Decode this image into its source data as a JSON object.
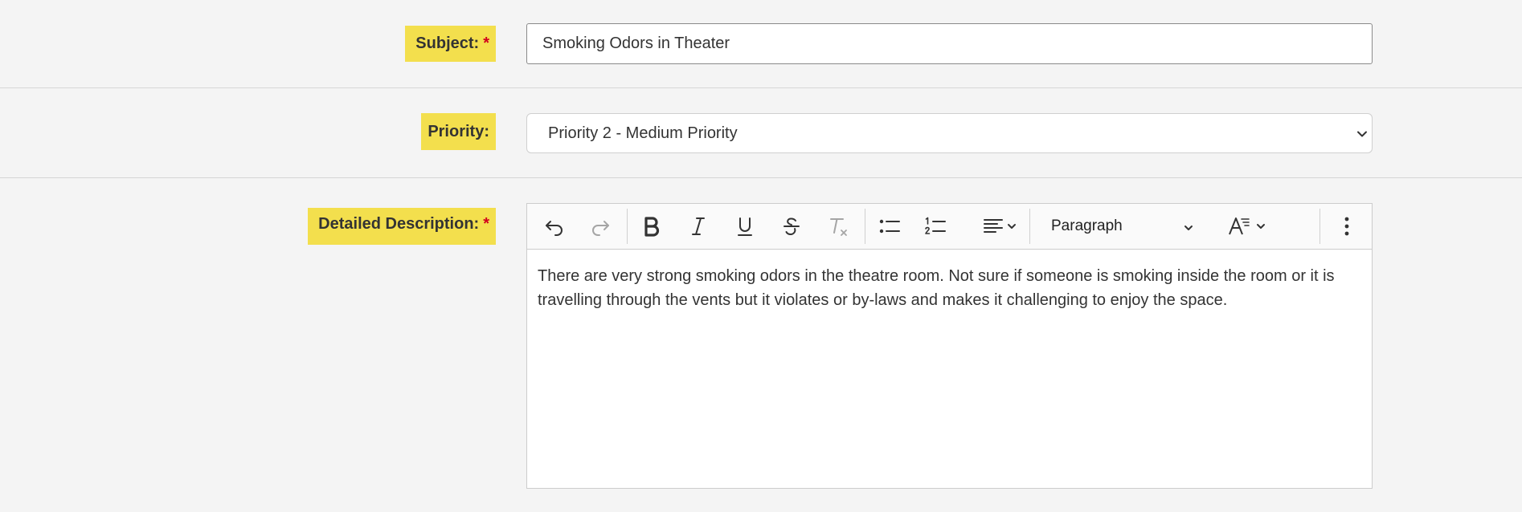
{
  "subject": {
    "label": "Subject:",
    "required_mark": "*",
    "value": "Smoking Odors in Theater"
  },
  "priority": {
    "label": "Priority:",
    "selected": "Priority 2 - Medium Priority"
  },
  "description": {
    "label": "Detailed Description:",
    "required_mark": "*",
    "toolbar": {
      "block_format": "Paragraph"
    },
    "content": "There are very strong smoking odors in the theatre room. Not sure if someone is smoking inside the room or it is travelling through the vents but it violates or by-laws and makes it challenging to enjoy the space."
  },
  "colors": {
    "label_highlight": "#f3df4d",
    "required": "#d1001c",
    "background": "#f4f4f4"
  },
  "icons": {
    "toolbar": [
      "undo-icon",
      "redo-icon",
      "bold-icon",
      "italic-icon",
      "underline-icon",
      "strikethrough-icon",
      "clear-formatting-icon",
      "bullet-list-icon",
      "numbered-list-icon",
      "align-icon",
      "font-size-icon",
      "more-icon"
    ]
  }
}
